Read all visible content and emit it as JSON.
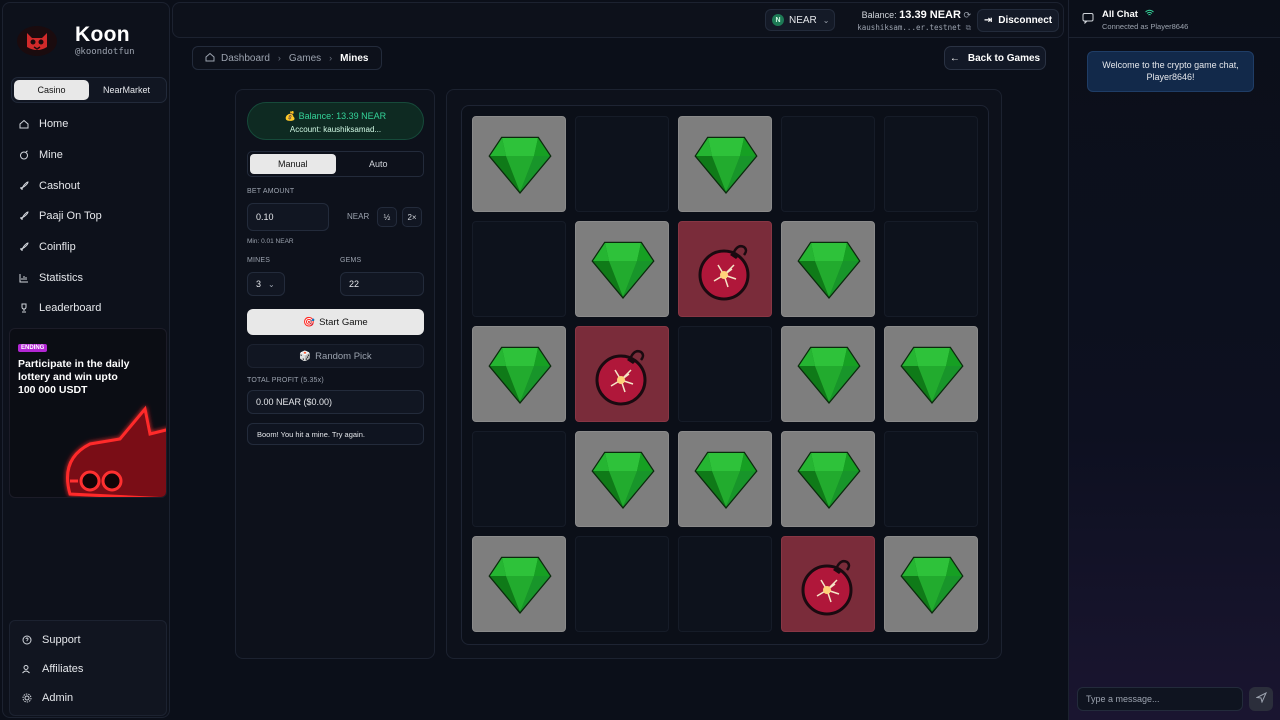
{
  "brand": {
    "title": "Koon",
    "handle": "@koondotfun"
  },
  "mode_toggle": {
    "casino": "Casino",
    "market": "NearMarket"
  },
  "nav": [
    {
      "label": "Home",
      "icon": "home-icon"
    },
    {
      "label": "Mine",
      "icon": "mine-icon"
    },
    {
      "label": "Cashout",
      "icon": "rocket-icon"
    },
    {
      "label": "Paaji On Top",
      "icon": "rocket-icon"
    },
    {
      "label": "Coinflip",
      "icon": "rocket-icon"
    },
    {
      "label": "Statistics",
      "icon": "chart-icon"
    },
    {
      "label": "Leaderboard",
      "icon": "trophy-icon"
    }
  ],
  "promo": {
    "badge": "ENDING",
    "text": "Participate in the daily lottery and win upto 100 000 USDT"
  },
  "bottom_nav": [
    {
      "label": "Support",
      "icon": "help-icon"
    },
    {
      "label": "Affiliates",
      "icon": "users-icon"
    },
    {
      "label": "Admin",
      "icon": "gear-icon"
    }
  ],
  "topbar": {
    "network": "NEAR",
    "balance_label": "Balance:",
    "balance_value": "13.39 NEAR",
    "account": "kaushiksam...er.testnet",
    "disconnect": "Disconnect"
  },
  "breadcrumb": {
    "dashboard": "Dashboard",
    "games": "Games",
    "current": "Mines"
  },
  "back_button": "Back to Games",
  "panel": {
    "balance_line": "Balance: 13.39 NEAR",
    "account_line": "Account: kaushiksamad...",
    "tab_manual": "Manual",
    "tab_auto": "Auto",
    "bet_label": "BET AMOUNT",
    "bet_value": "0.10",
    "bet_unit": "NEAR",
    "half": "½",
    "double": "2×",
    "min_note": "Min: 0.01 NEAR",
    "mines_label": "MINES",
    "mines_value": "3",
    "gems_label": "GEMS",
    "gems_value": "22",
    "start": "Start Game",
    "random": "Random Pick",
    "profit_label": "TOTAL PROFIT (5.35x)",
    "profit_value": "0.00 NEAR ($0.00)",
    "message": "Boom! You hit a mine. Try again."
  },
  "board": {
    "rows": [
      [
        "gem",
        "empty",
        "gem",
        "empty",
        "empty"
      ],
      [
        "empty",
        "gem",
        "bomb",
        "gem",
        "empty"
      ],
      [
        "gem",
        "bomb",
        "empty",
        "gem",
        "gem"
      ],
      [
        "empty",
        "gem",
        "gem",
        "gem",
        "empty"
      ],
      [
        "gem",
        "empty",
        "empty",
        "bomb",
        "gem"
      ]
    ]
  },
  "chat": {
    "title": "All Chat",
    "subtitle": "Connected as Player8646",
    "welcome": "Welcome to the crypto game chat, Player8646!",
    "placeholder": "Type a message..."
  },
  "colors": {
    "gem": "#1fa32a",
    "bomb_tile": "#7a2c3a",
    "balance_green": "#34d399"
  }
}
